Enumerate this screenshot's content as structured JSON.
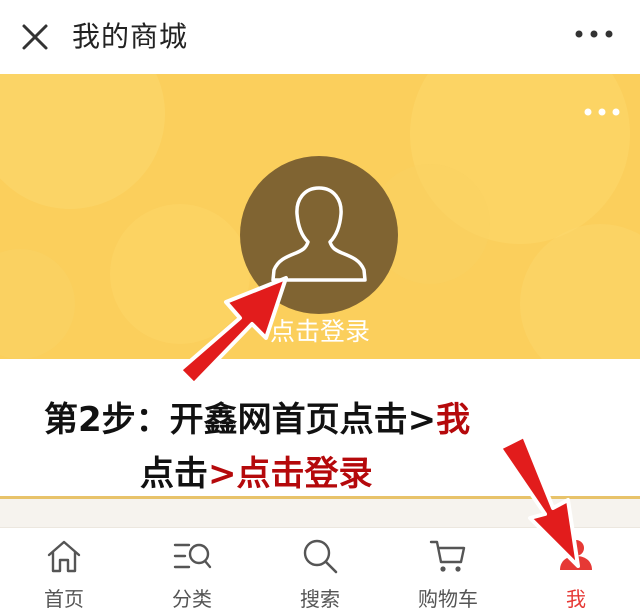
{
  "header": {
    "title": "我的商城",
    "close_icon": "close-icon",
    "more_icon": "more-icon"
  },
  "profile": {
    "login_text": "点击登录",
    "avatar_icon": "person-avatar-icon",
    "menu_icon": "more-icon"
  },
  "instruction": {
    "line1_prefix": "第2步：开鑫网首页点击>",
    "line1_highlight": "我",
    "line2_prefix": "点击",
    "line2_highlight": ">点击登录",
    "text_color": "#111111",
    "highlight_color": "#b5090b"
  },
  "tabbar": {
    "items": [
      {
        "label": "首页",
        "icon": "home-icon"
      },
      {
        "label": "分类",
        "icon": "category-search-icon"
      },
      {
        "label": "搜索",
        "icon": "search-icon"
      },
      {
        "label": "购物车",
        "icon": "cart-icon"
      },
      {
        "label": "我",
        "icon": "profile-icon",
        "active": true
      }
    ]
  },
  "colors": {
    "banner": "#fbcf5c",
    "avatar": "#806432",
    "active_tab": "#e63935",
    "arrow": "#e21c1c"
  }
}
